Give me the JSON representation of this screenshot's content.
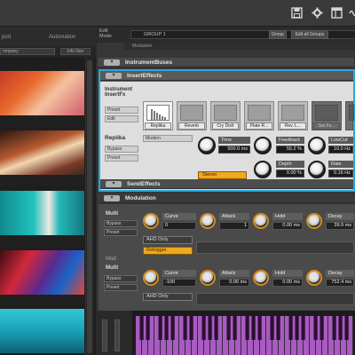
{
  "colors": {
    "accent": "#2aa7e0",
    "orange": "#f0a820",
    "keys": "#a85bc0"
  },
  "toolbar": {
    "save_icon": "save-icon",
    "settings_icon": "gear-icon",
    "layout_icon": "layout-icon",
    "ripple_icon": "wave-icon"
  },
  "browser": {
    "header_left": "port",
    "header_right": "Automation",
    "dropdown": "ompany",
    "button": "Info Nav"
  },
  "edit": {
    "mode_label_1": "Edit",
    "mode_label_2": "Mode",
    "group_label": "GROUP 1",
    "group_btn": "Group",
    "edit_all_btn": "Edit all Groups",
    "instrument_line": "Modulator"
  },
  "sections": {
    "instrument_buses": "InstrumentBuses",
    "insert_effects": "InsertEffects",
    "send_effects": "SendEffects",
    "modulation": "Modulation"
  },
  "insert": {
    "instrument_label_1": "Instrument",
    "instrument_label_2": "InsertFx",
    "preset": "Preset",
    "edit": "Edit",
    "fx_name": "Replika",
    "bypass": "Bypass",
    "preset2": "Preset",
    "mode": "Modern",
    "slots": [
      "Replika",
      "Reverb",
      "Cry Dish",
      "Plate R...",
      "Rev. L...",
      "Set Fx...",
      ""
    ],
    "params": {
      "time_label": "Time",
      "time_value": "500.0",
      "time_unit": "ms",
      "feedback_label": "Feedback",
      "feedback_value": "55.2",
      "feedback_unit": "%",
      "lowcut_label": "LowCut",
      "lowcut_value": "10.0",
      "lowcut_unit": "Hz",
      "depth_label": "Depth",
      "depth_value": "0.00",
      "depth_unit": "%",
      "rate_label": "Rate",
      "rate_value": "0.16",
      "rate_unit": "Hz",
      "stereo_label": "Stereo"
    }
  },
  "modulation": {
    "rows": [
      {
        "name": "Multi",
        "bypass": "Bypass",
        "preset": "Preset",
        "curve_label": "Curve",
        "curve_value": "0",
        "attack_label": "Attack",
        "attack_value": "1",
        "hold_label": "Hold",
        "hold_value": "0.00",
        "hold_unit": "ms",
        "decay_label": "Decay",
        "decay_value": "39.9",
        "decay_unit": "ms",
        "ahd_btn": "AHD Only",
        "retrigger_btn": "Retrigger"
      },
      {
        "name": "Multi",
        "bypass": "Bypass",
        "preset": "Preset",
        "curve_label": "Curve",
        "curve_value": "-100",
        "attack_label": "Attack",
        "attack_value": "0.00",
        "attack_unit": "ms",
        "hold_label": "Hold",
        "hold_value": "0.00",
        "hold_unit": "ms",
        "decay_label": "Decay",
        "decay_value": "752.4",
        "decay_unit": "ms",
        "ahd_btn": "AHD Only"
      }
    ],
    "mod_label": "Mod"
  }
}
